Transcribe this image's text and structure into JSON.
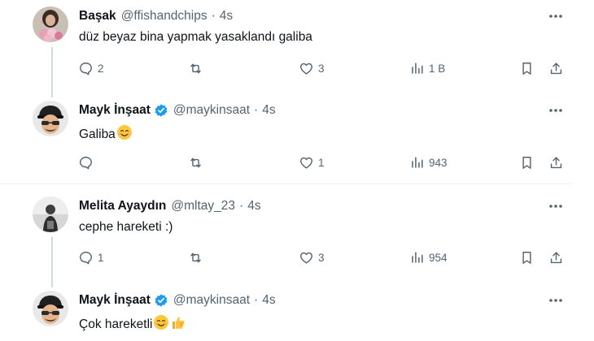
{
  "tweets": [
    {
      "name": "Başak",
      "handle": "@ffishandchips",
      "time": "4s",
      "verified": false,
      "avatar": "avatar-woman-with-flowers",
      "text": "düz beyaz bina yapmak yasaklandı galiba",
      "emojis": [],
      "stats": {
        "reply": "2",
        "retweet": "",
        "like": "3",
        "views": "1 B"
      }
    },
    {
      "name": "Mayk İnşaat",
      "handle": "@maykinsaat",
      "time": "4s",
      "verified": true,
      "avatar": "avatar-cartoon-man-cap",
      "text": "Galiba",
      "emojis": [
        "smiling-face-emoji"
      ],
      "stats": {
        "reply": "",
        "retweet": "",
        "like": "1",
        "views": "943"
      }
    },
    {
      "name": "Melita Ayaydın",
      "handle": "@mltay_23",
      "time": "4s",
      "verified": false,
      "avatar": "avatar-person-grayscale",
      "text": "cephe hareketi :)",
      "emojis": [],
      "stats": {
        "reply": "1",
        "retweet": "",
        "like": "3",
        "views": "954"
      }
    },
    {
      "name": "Mayk İnşaat",
      "handle": "@maykinsaat",
      "time": "4s",
      "verified": true,
      "avatar": "avatar-cartoon-man-cap",
      "text": "Çok hareketli",
      "emojis": [
        "smiling-face-emoji",
        "thumbs-up-emoji"
      ]
    }
  ],
  "colors": {
    "text": "#0f1419",
    "secondary": "#536471",
    "verified": "#1d9bf0",
    "border": "#cfd9de"
  },
  "icons": {
    "reply": "reply-icon",
    "retweet": "retweet-icon",
    "like": "heart-icon",
    "views": "views-icon",
    "bookmark": "bookmark-icon",
    "share": "share-icon",
    "more": "more-icon"
  }
}
